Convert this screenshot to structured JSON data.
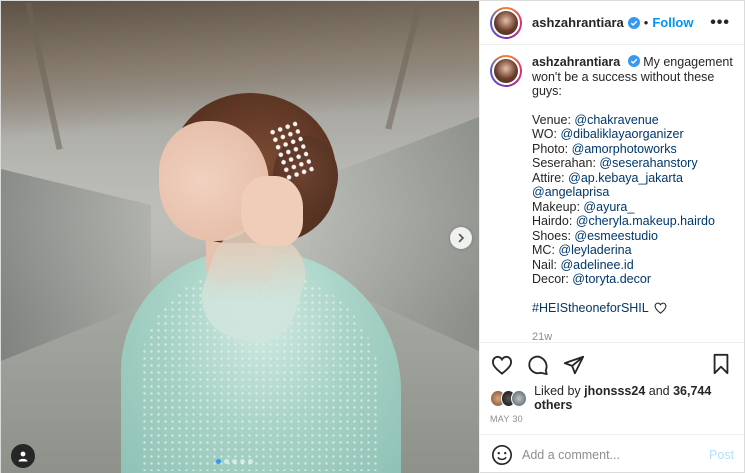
{
  "header": {
    "username": "ashzahrantiara",
    "separator": "•",
    "follow_label": "Follow",
    "more_label": "•••"
  },
  "caption": {
    "username": "ashzahrantiara",
    "intro": "My engagement won't be a success without these guys:",
    "credits": [
      {
        "label": "Venue: ",
        "handle": "@chakravenue"
      },
      {
        "label": "WO: ",
        "handle": "@dibaliklayaorganizer"
      },
      {
        "label": "Photo: ",
        "handle": "@amorphotoworks"
      },
      {
        "label": "Seserahan: ",
        "handle": "@seserahanstory"
      },
      {
        "label": "Attire: ",
        "handle": "@ap.kebaya_jakarta @angelaprisa"
      },
      {
        "label": "Makeup: ",
        "handle": "@ayura_"
      },
      {
        "label": "Hairdo: ",
        "handle": "@cheryla.makeup.hairdo"
      },
      {
        "label": "Shoes: ",
        "handle": "@esmeestudio"
      },
      {
        "label": "MC: ",
        "handle": "@leyladerina"
      },
      {
        "label": "Nail: ",
        "handle": "@adelinee.id"
      },
      {
        "label": "Decor: ",
        "handle": "@toryta.decor"
      }
    ],
    "hashtag": "#HEIStheoneforSHIL",
    "time_ago": "21w"
  },
  "likes": {
    "prefix": "Liked by ",
    "user": "jhonsss24",
    "middle": " and ",
    "count": "36,744 others"
  },
  "date": "MAY 30",
  "comment": {
    "placeholder": "Add a comment...",
    "post_label": "Post"
  },
  "carousel": {
    "total": 5,
    "active_index": 0
  },
  "colors": {
    "accent": "#0095f6",
    "link": "#00376b",
    "muted": "#8e8e8e",
    "active_dot": "#3897f0"
  },
  "icons": [
    "verified-icon",
    "more-icon",
    "heart-icon",
    "comment-icon",
    "share-icon",
    "bookmark-icon",
    "chevron-right-icon",
    "user-tag-icon",
    "emoji-icon"
  ]
}
